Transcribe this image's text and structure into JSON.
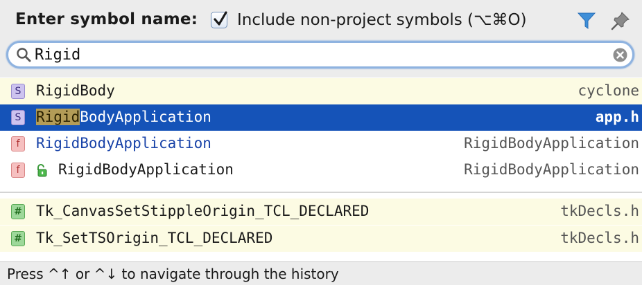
{
  "header": {
    "title": "Enter symbol name:",
    "include_label": "Include non-project symbols (⌥⌘O)",
    "include_checked": true
  },
  "search": {
    "query": "Rigid"
  },
  "results": [
    {
      "badge": "S",
      "kind": "struct",
      "match": "Rigid",
      "rest": "Body",
      "location": "cyclone",
      "selected": false
    },
    {
      "badge": "S",
      "kind": "struct",
      "match": "Rigid",
      "rest": "BodyApplication",
      "location": "app.h",
      "selected": true
    },
    {
      "badge": "f",
      "kind": "function",
      "name": "RigidBodyApplication",
      "location": "RigidBodyApplication",
      "selected": false
    },
    {
      "badge": "f",
      "kind": "function",
      "name": "RigidBodyApplication",
      "location": "RigidBodyApplication",
      "selected": false,
      "icon": "lock-open-icon"
    }
  ],
  "other_results": [
    {
      "badge": "#",
      "kind": "macro",
      "name": "Tk_CanvasSetStippleOrigin_TCL_DECLARED",
      "location": "tkDecls.h"
    },
    {
      "badge": "#",
      "kind": "macro",
      "name": "Tk_SetTSOrigin_TCL_DECLARED",
      "location": "tkDecls.h"
    }
  ],
  "footer": {
    "hint": "Press ^↑ or ^↓ to navigate through the history"
  },
  "colors": {
    "selection": "#1553b8",
    "highlight": "#b39c57",
    "search_border": "#8fb3e0",
    "filter_icon": "#3f8fd8"
  }
}
